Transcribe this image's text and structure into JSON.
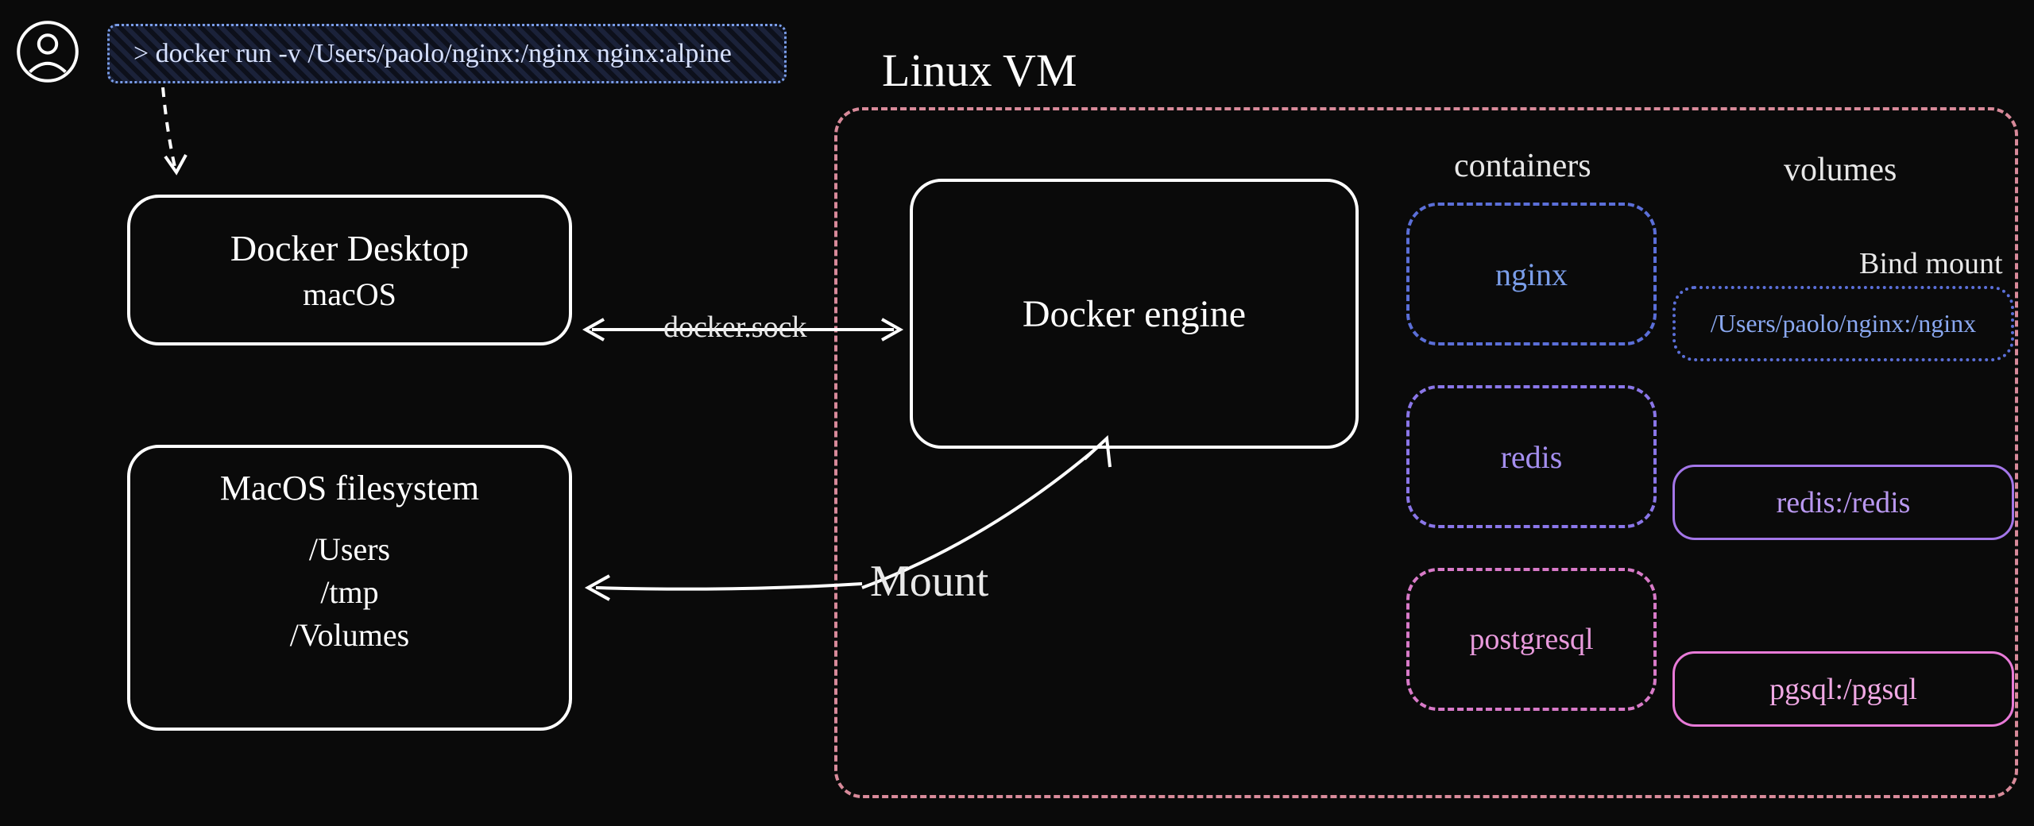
{
  "command": "> docker run -v /Users/paolo/nginx:/nginx nginx:alpine",
  "vm_label": "Linux VM",
  "docker_desktop": {
    "title": "Docker Desktop",
    "subtitle": "macOS"
  },
  "macos_fs": {
    "title": "MacOS filesystem",
    "paths": [
      "/Users",
      "/tmp",
      "/Volumes"
    ]
  },
  "docker_engine": "Docker engine",
  "labels": {
    "containers": "containers",
    "volumes": "volumes",
    "bind_mount": "Bind mount",
    "mount": "Mount",
    "docker_sock": "docker.sock"
  },
  "containers": {
    "nginx": "nginx",
    "redis": "redis",
    "postgres": "postgresql"
  },
  "volumes": {
    "bind": "/Users/paolo/nginx:/nginx",
    "redis": "redis:/redis",
    "pgsql": "pgsql:/pgsql"
  }
}
